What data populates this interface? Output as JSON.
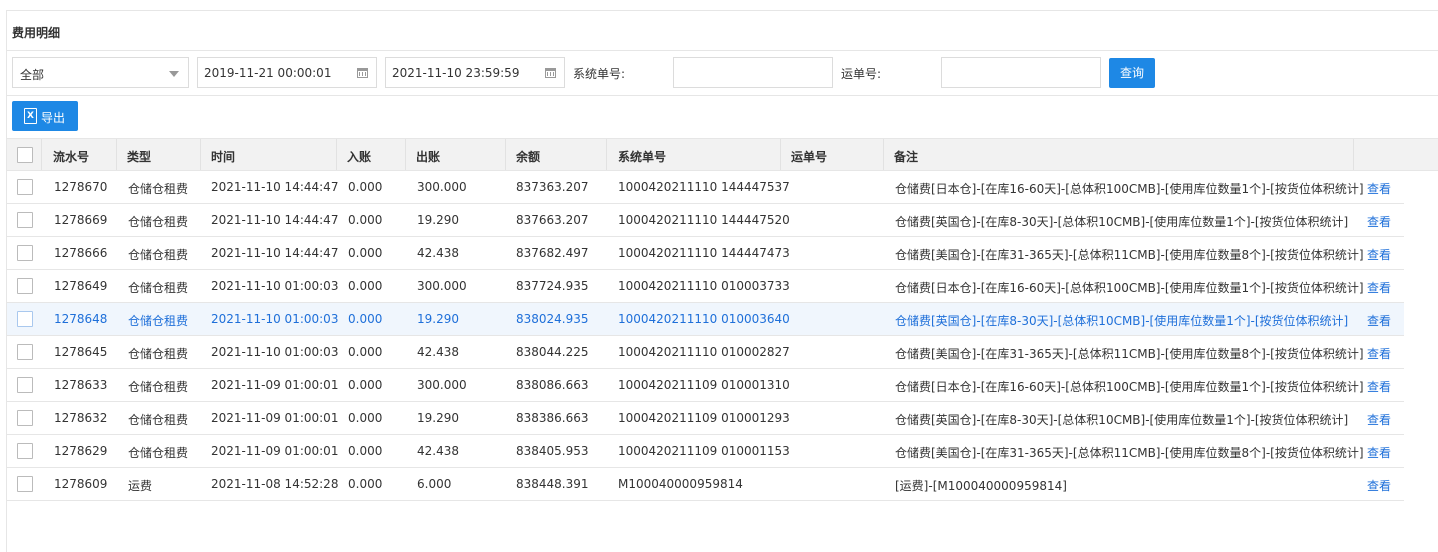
{
  "panel": {
    "title": "费用明细"
  },
  "filters": {
    "type_select": "全部",
    "start_date": "2019-11-21 00:00:01",
    "end_date": "2021-11-10 23:59:59",
    "system_no_label": "系统单号:",
    "system_no_value": "",
    "waybill_label": "运单号:",
    "waybill_value": "",
    "query_label": "查询"
  },
  "toolbar": {
    "export_label": "导出",
    "export_icon": "excel-icon"
  },
  "table": {
    "headers": [
      "流水号",
      "类型",
      "时间",
      "入账",
      "出账",
      "余额",
      "系统单号",
      "运单号",
      "备注"
    ],
    "view_label": "查看",
    "highlighted_row": 4,
    "rows": [
      {
        "id": "1278670",
        "type": "仓储仓租费",
        "time": "2021-11-10 14:44:47",
        "in": "0.000",
        "out": "300.000",
        "balance": "837363.207",
        "sys_no": "1000420211110 144447537",
        "waybill": "",
        "remark": "仓储费[日本仓]-[在库16-60天]-[总体积100CMB]-[使用库位数量1个]-[按货位体积统计]"
      },
      {
        "id": "1278669",
        "type": "仓储仓租费",
        "time": "2021-11-10 14:44:47",
        "in": "0.000",
        "out": "19.290",
        "balance": "837663.207",
        "sys_no": "1000420211110 144447520",
        "waybill": "",
        "remark": "仓储费[英国仓]-[在库8-30天]-[总体积10CMB]-[使用库位数量1个]-[按货位体积统计]"
      },
      {
        "id": "1278666",
        "type": "仓储仓租费",
        "time": "2021-11-10 14:44:47",
        "in": "0.000",
        "out": "42.438",
        "balance": "837682.497",
        "sys_no": "1000420211110 144447473",
        "waybill": "",
        "remark": "仓储费[美国仓]-[在库31-365天]-[总体积11CMB]-[使用库位数量8个]-[按货位体积统计]"
      },
      {
        "id": "1278649",
        "type": "仓储仓租费",
        "time": "2021-11-10 01:00:03",
        "in": "0.000",
        "out": "300.000",
        "balance": "837724.935",
        "sys_no": "1000420211110 010003733",
        "waybill": "",
        "remark": "仓储费[日本仓]-[在库16-60天]-[总体积100CMB]-[使用库位数量1个]-[按货位体积统计]"
      },
      {
        "id": "1278648",
        "type": "仓储仓租费",
        "time": "2021-11-10 01:00:03",
        "in": "0.000",
        "out": "19.290",
        "balance": "838024.935",
        "sys_no": "1000420211110 010003640",
        "waybill": "",
        "remark": "仓储费[英国仓]-[在库8-30天]-[总体积10CMB]-[使用库位数量1个]-[按货位体积统计]"
      },
      {
        "id": "1278645",
        "type": "仓储仓租费",
        "time": "2021-11-10 01:00:03",
        "in": "0.000",
        "out": "42.438",
        "balance": "838044.225",
        "sys_no": "1000420211110 010002827",
        "waybill": "",
        "remark": "仓储费[美国仓]-[在库31-365天]-[总体积11CMB]-[使用库位数量8个]-[按货位体积统计]"
      },
      {
        "id": "1278633",
        "type": "仓储仓租费",
        "time": "2021-11-09 01:00:01",
        "in": "0.000",
        "out": "300.000",
        "balance": "838086.663",
        "sys_no": "1000420211109 010001310",
        "waybill": "",
        "remark": "仓储费[日本仓]-[在库16-60天]-[总体积100CMB]-[使用库位数量1个]-[按货位体积统计]"
      },
      {
        "id": "1278632",
        "type": "仓储仓租费",
        "time": "2021-11-09 01:00:01",
        "in": "0.000",
        "out": "19.290",
        "balance": "838386.663",
        "sys_no": "1000420211109 010001293",
        "waybill": "",
        "remark": "仓储费[英国仓]-[在库8-30天]-[总体积10CMB]-[使用库位数量1个]-[按货位体积统计]"
      },
      {
        "id": "1278629",
        "type": "仓储仓租费",
        "time": "2021-11-09 01:00:01",
        "in": "0.000",
        "out": "42.438",
        "balance": "838405.953",
        "sys_no": "1000420211109 010001153",
        "waybill": "",
        "remark": "仓储费[美国仓]-[在库31-365天]-[总体积11CMB]-[使用库位数量8个]-[按货位体积统计]"
      },
      {
        "id": "1278609",
        "type": "运费",
        "time": "2021-11-08 14:52:28",
        "in": "0.000",
        "out": "6.000",
        "balance": "838448.391",
        "sys_no": "M100040000959814",
        "waybill": "",
        "remark": "[运费]-[M100040000959814]"
      }
    ]
  }
}
